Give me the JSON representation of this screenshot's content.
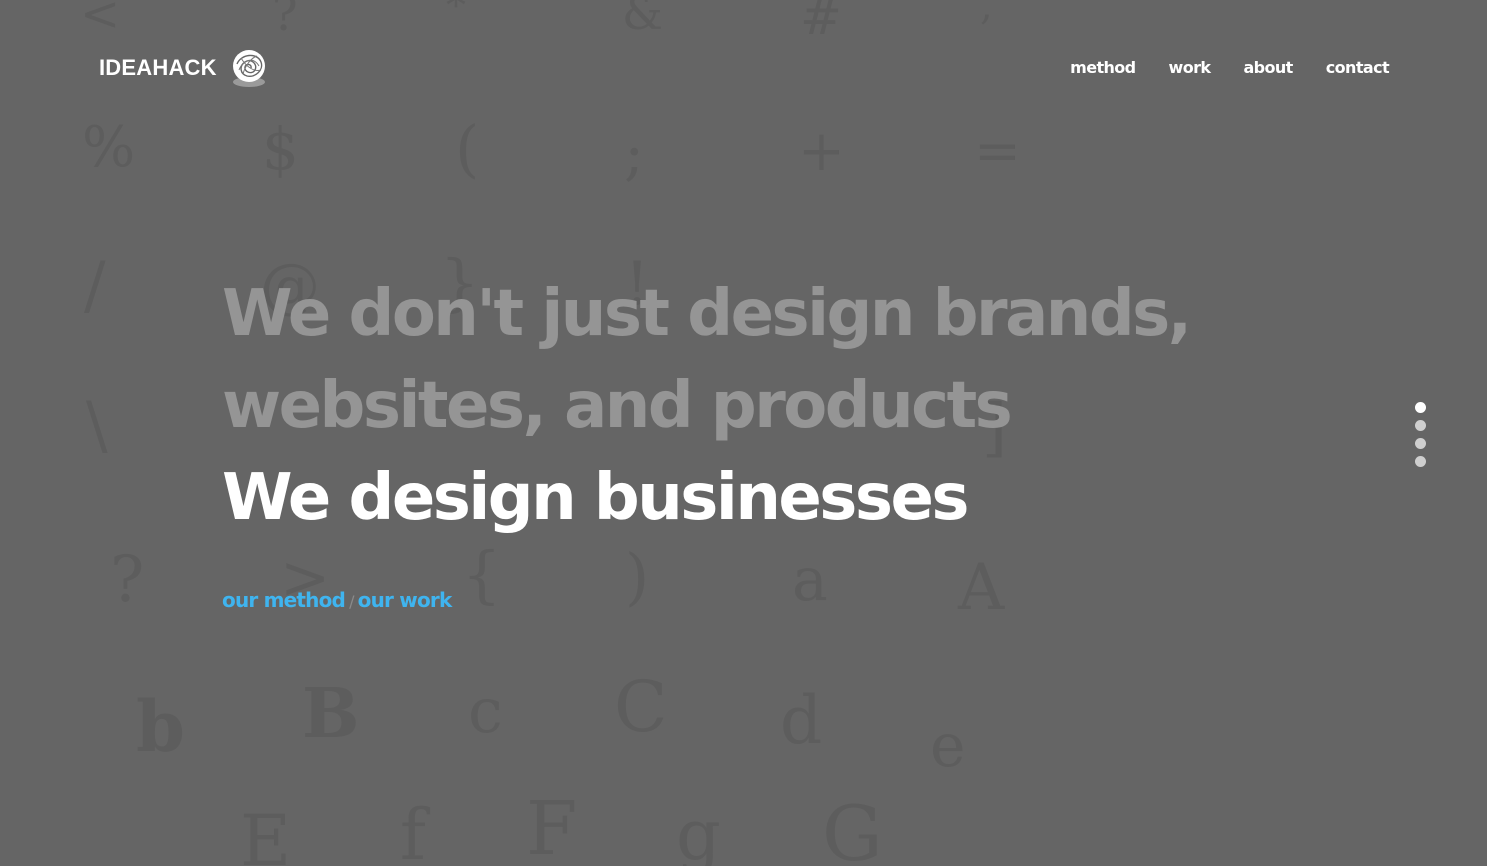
{
  "brand": {
    "name": "IDEAHACK",
    "logo_icon": "scribble-ball-icon"
  },
  "nav": {
    "items": [
      {
        "label": "method"
      },
      {
        "label": "work"
      },
      {
        "label": "about"
      },
      {
        "label": "contact"
      }
    ]
  },
  "hero": {
    "line1": "We don't just design brands,",
    "line2": "websites, and products",
    "line3": "We design businesses"
  },
  "cta": {
    "method_label": "our method",
    "separator": "/",
    "work_label": "our work"
  },
  "section_dots": {
    "count": 4,
    "active_index": 0
  },
  "colors": {
    "background": "#656565",
    "accent": "#3fb4ef",
    "muted_text": "#959595",
    "text": "#ffffff"
  }
}
